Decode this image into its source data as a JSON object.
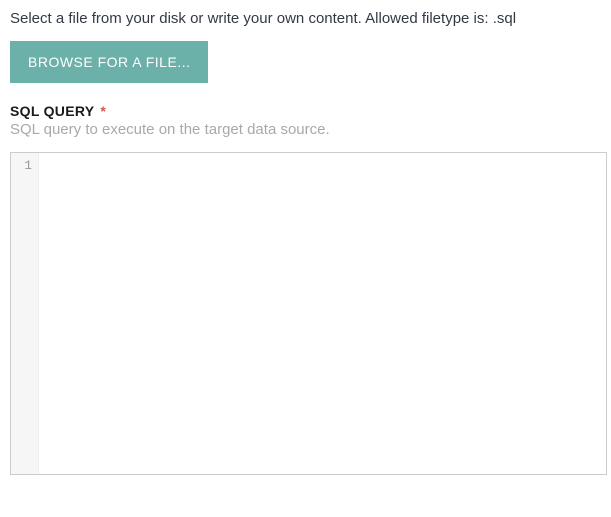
{
  "file_section": {
    "help_text": "Select a file from your disk or write your own content. Allowed filetype is: .sql",
    "browse_button_label": "BROWSE FOR A FILE..."
  },
  "sql_query": {
    "label": "SQL QUERY",
    "required_marker": "*",
    "description": "SQL query to execute on the target data source.",
    "line_numbers": [
      "1"
    ],
    "value": ""
  }
}
